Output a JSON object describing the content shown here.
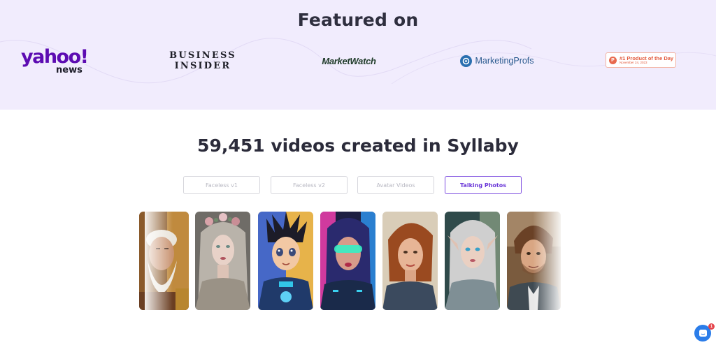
{
  "featured": {
    "title": "Featured on",
    "logos": {
      "yahoo_main": "yahoo!",
      "yahoo_sub": "news",
      "bi_line1": "BUSINESS",
      "bi_line2": "INSIDER",
      "marketwatch": "MarketWatch",
      "marketingprofs": "MarketingProfs",
      "producthunt_icon": "P",
      "producthunt_main": "#1 Product of the Day",
      "producthunt_date": "November 24, 2023"
    }
  },
  "stats": {
    "title": "59,451 videos created in Syllaby"
  },
  "tabs": [
    {
      "label": "Faceless v1",
      "active": false
    },
    {
      "label": "Faceless v2",
      "active": false
    },
    {
      "label": "Avatar Videos",
      "active": false
    },
    {
      "label": "Talking Photos",
      "active": true
    }
  ],
  "gallery": [
    {
      "subject": "old-bearded-man-portrait"
    },
    {
      "subject": "floral-crown-woman-portrait"
    },
    {
      "subject": "anime-boy-portrait"
    },
    {
      "subject": "cyberpunk-visor-woman-portrait"
    },
    {
      "subject": "auburn-hair-woman-portrait"
    },
    {
      "subject": "elf-woman-portrait"
    },
    {
      "subject": "young-man-portrait"
    }
  ],
  "chat": {
    "badge_count": "1",
    "icon": "chat-bubble-icon"
  },
  "colors": {
    "accent": "#7c4ce0",
    "featured_bg": "#f1ecfd",
    "yahoo_purple": "#5d0cb2",
    "producthunt_orange": "#e2593c",
    "chat_blue": "#2b7de9"
  }
}
